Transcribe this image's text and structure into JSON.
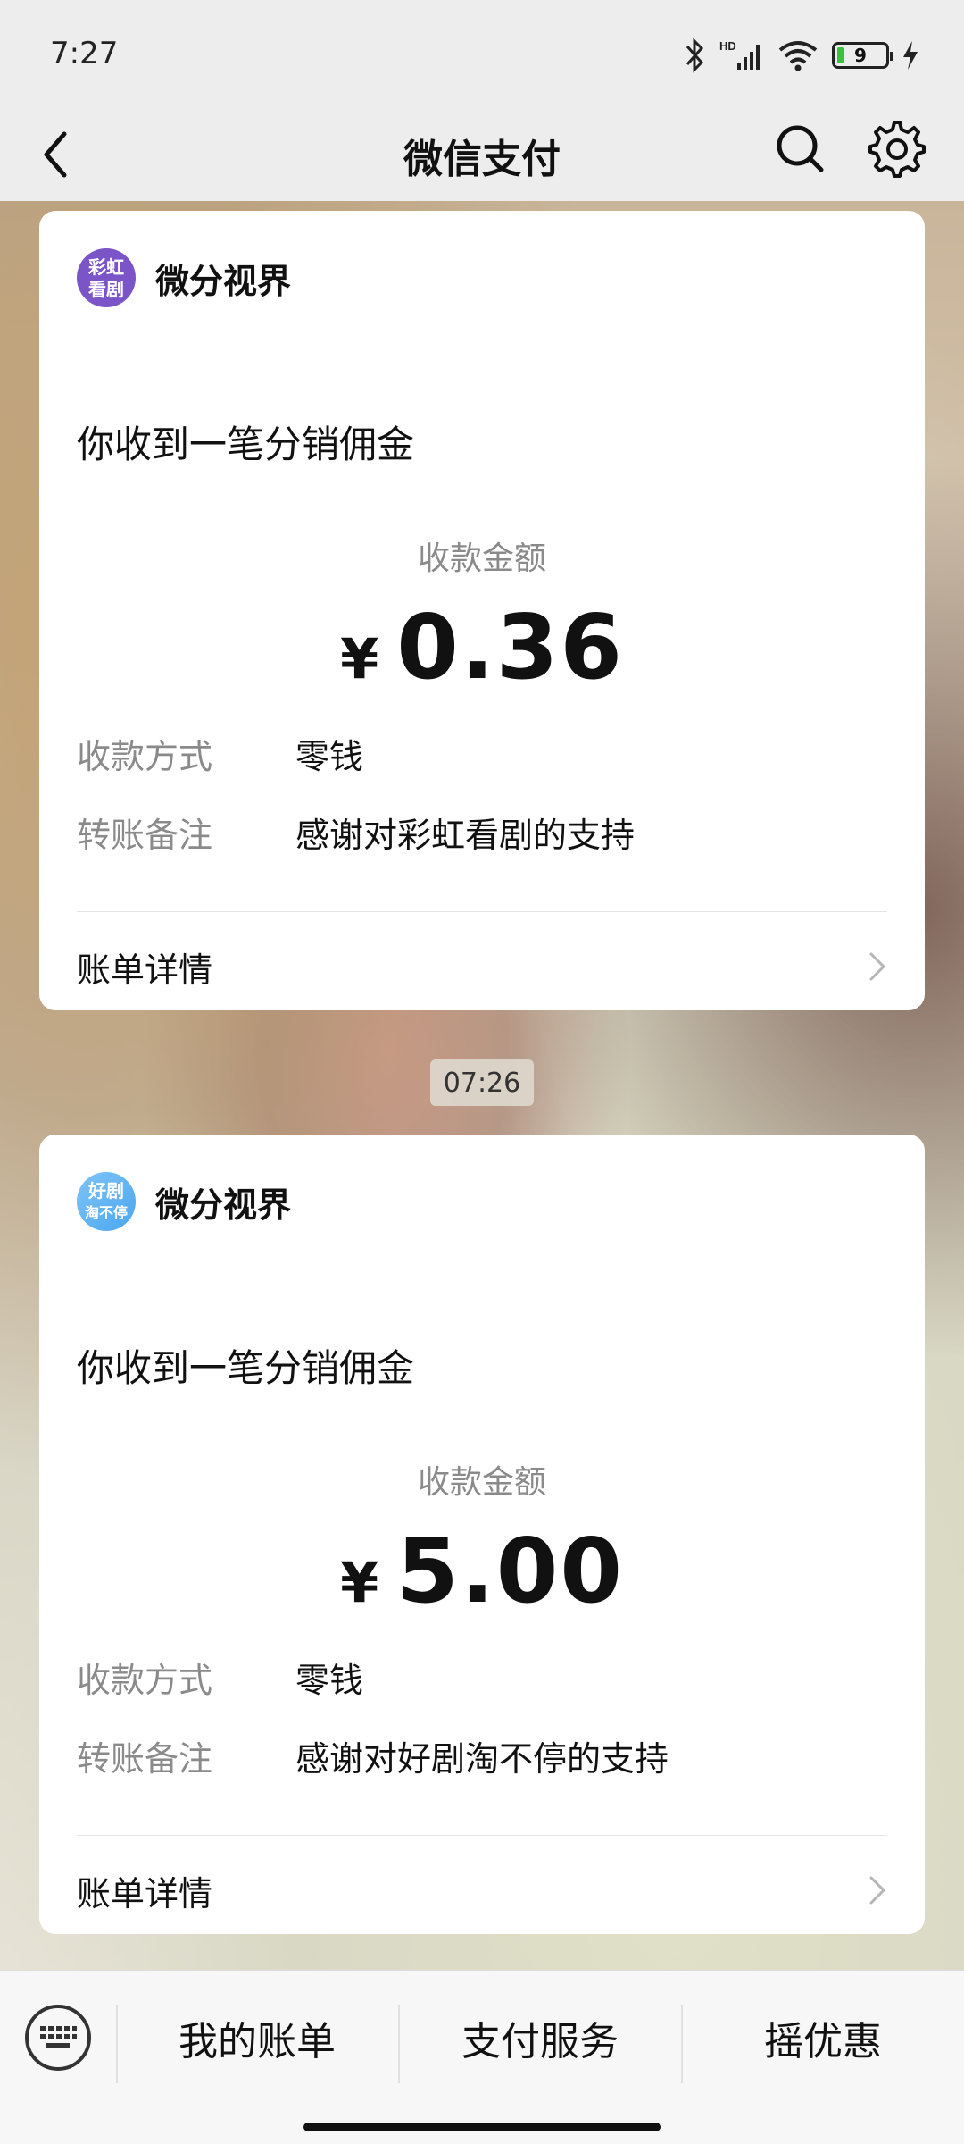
{
  "status_bar": {
    "time": "7:27",
    "hd_label": "HD",
    "battery": "9"
  },
  "nav": {
    "title": "微信支付"
  },
  "messages": [
    {
      "merchant_name": "微分视界",
      "avatar_text": [
        "彩虹",
        "看剧"
      ],
      "notice_title": "你收到一笔分销佣金",
      "amount_label": "收款金额",
      "currency": "¥",
      "amount": "0.36",
      "method_label": "收款方式",
      "method_value": "零钱",
      "remark_label": "转账备注",
      "remark_value": "感谢对彩虹看剧的支持",
      "detail_label": "账单详情"
    },
    {
      "merchant_name": "微分视界",
      "avatar_text": [
        "好剧",
        "淘不停"
      ],
      "notice_title": "你收到一笔分销佣金",
      "amount_label": "收款金额",
      "currency": "¥",
      "amount": "5.00",
      "method_label": "收款方式",
      "method_value": "零钱",
      "remark_label": "转账备注",
      "remark_value": "感谢对好剧淘不停的支持",
      "detail_label": "账单详情"
    }
  ],
  "timestamp": "07:26",
  "bottom_menu": [
    {
      "label": "我的账单"
    },
    {
      "label": "支付服务"
    },
    {
      "label": "摇优惠"
    }
  ],
  "colors": {
    "background": "#ededed",
    "card": "#ffffff",
    "secondary_text": "#8a8a8a",
    "avatar_1": "#7b55c8",
    "avatar_2": "#4aa6f0",
    "battery_fill": "#3bc13b"
  }
}
